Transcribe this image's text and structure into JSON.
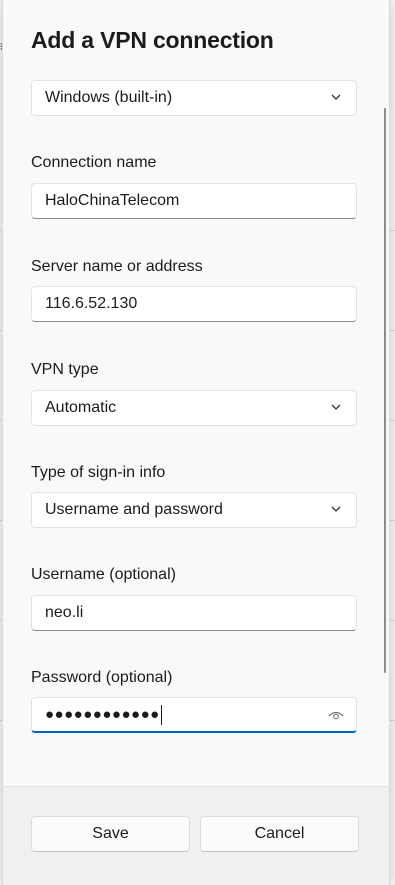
{
  "dialog": {
    "title": "Add a VPN connection",
    "provider": {
      "value": "Windows (built-in)"
    },
    "connection_name": {
      "label": "Connection name",
      "value": "HaloChinaTelecom"
    },
    "server": {
      "label": "Server name or address",
      "value": "116.6.52.130"
    },
    "vpn_type": {
      "label": "VPN type",
      "value": "Automatic"
    },
    "sign_in_type": {
      "label": "Type of sign-in info",
      "value": "Username and password"
    },
    "username": {
      "label": "Username (optional)",
      "value": "neo.li"
    },
    "password": {
      "label": "Password (optional)",
      "value": "●●●●●●●●●●●●"
    },
    "save_label": "Save",
    "cancel_label": "Cancel"
  },
  "colors": {
    "accent": "#0067c0",
    "surface": "#f9f9f9",
    "footer": "#f0f0f0"
  },
  "icons": [
    "chevron-down-icon",
    "eye-icon",
    "menu-icon"
  ]
}
